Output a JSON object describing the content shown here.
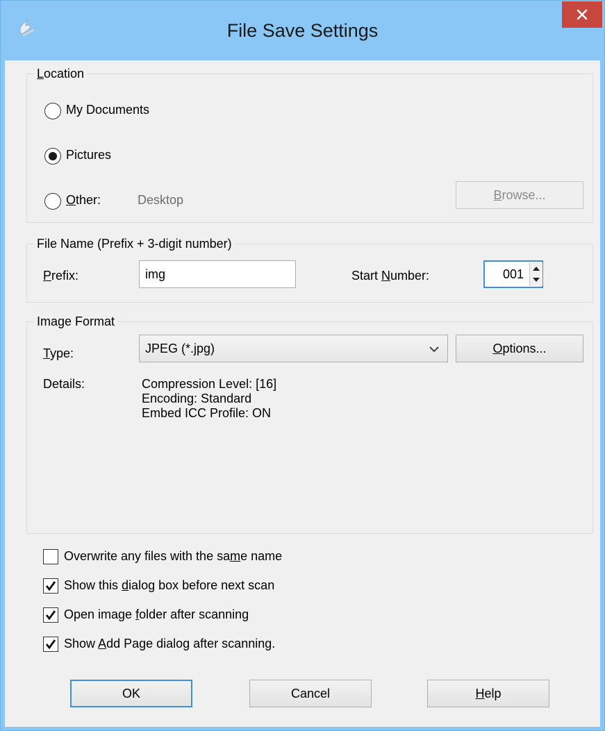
{
  "window": {
    "title": "File Save Settings"
  },
  "location": {
    "legend_pre": "",
    "legend_u": "L",
    "legend_post": "ocation",
    "options": [
      {
        "label": "My Documents",
        "checked": false
      },
      {
        "label": "Pictures",
        "checked": true
      },
      {
        "label_u": "O",
        "label_post": "ther:",
        "checked": false,
        "path": "Desktop"
      }
    ],
    "browse": {
      "pre": "",
      "u": "B",
      "post": "rowse...",
      "disabled": true
    }
  },
  "file_name": {
    "legend": "File Name (Prefix + 3-digit number)",
    "prefix_label_u": "P",
    "prefix_label_post": "refix:",
    "prefix_value": "img",
    "start_label_pre": "Start ",
    "start_label_u": "N",
    "start_label_post": "umber:",
    "start_value": "001"
  },
  "image_format": {
    "legend": "Image Format",
    "type_label_u": "T",
    "type_label_post": "ype:",
    "type_value": "JPEG (*.jpg)",
    "options_button_u": "O",
    "options_button_post": "ptions...",
    "details_label": "Details:",
    "details": [
      "Compression Level: [16]",
      "Encoding: Standard",
      "Embed ICC Profile: ON"
    ]
  },
  "checkboxes": [
    {
      "pre": "Overwrite any files with the sa",
      "u": "m",
      "post": "e name",
      "checked": false
    },
    {
      "pre": "Show this ",
      "u": "d",
      "post": "ialog box before next scan",
      "checked": true
    },
    {
      "pre": "Open image ",
      "u": "f",
      "post": "older after scanning",
      "checked": true
    },
    {
      "pre": "Show ",
      "u": "A",
      "post": "dd Page dialog after scanning.",
      "checked": true
    }
  ],
  "buttons": {
    "ok": "OK",
    "cancel": "Cancel",
    "help_u": "H",
    "help_post": "elp"
  },
  "colors": {
    "titlebar": "#8ac7f6",
    "close": "#c7473f",
    "client": "#f0f0f0",
    "default_border": "#3c8fd8"
  }
}
